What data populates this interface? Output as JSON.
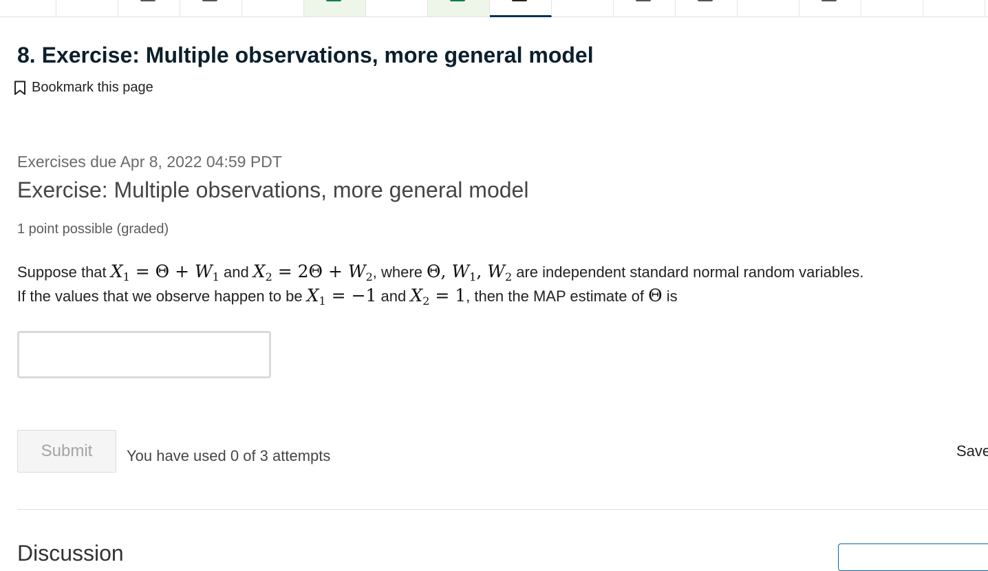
{
  "unit": {
    "title": "8. Exercise: Multiple observations, more general model",
    "bookmark_label": "Bookmark this page"
  },
  "problem": {
    "due": "Exercises due Apr 8, 2022 04:59 PDT",
    "title": "Exercise: Multiple observations, more general model",
    "points": "1 point possible (graded)",
    "line1": {
      "t1": "Suppose that ",
      "t2": " and ",
      "t3": ", where ",
      "t4": " are independent standard normal random variables."
    },
    "line2": {
      "t1": "If the values that we observe happen to be ",
      "t2": " and ",
      "t3": ", then the MAP estimate of ",
      "t4": " is"
    },
    "answer_value": "",
    "submit_label": "Submit",
    "attempts": "You have used 0 of 3 attempts",
    "save_label": "Save"
  },
  "discussion": {
    "heading": "Discussion"
  },
  "tabs": [
    {
      "state": "normal"
    },
    {
      "state": "normal"
    },
    {
      "state": "normal"
    },
    {
      "state": "normal"
    },
    {
      "state": "complete"
    },
    {
      "state": "normal"
    },
    {
      "state": "complete"
    },
    {
      "state": "active"
    },
    {
      "state": "normal"
    },
    {
      "state": "normal"
    },
    {
      "state": "normal"
    },
    {
      "state": "normal"
    },
    {
      "state": "normal"
    },
    {
      "state": "normal"
    },
    {
      "state": "normal"
    }
  ],
  "colors": {
    "title": "#0b1f2c",
    "active_tab": "#0a3055",
    "complete_tab_bg": "#edf6e8",
    "complete_icon": "#0d7d4d"
  }
}
